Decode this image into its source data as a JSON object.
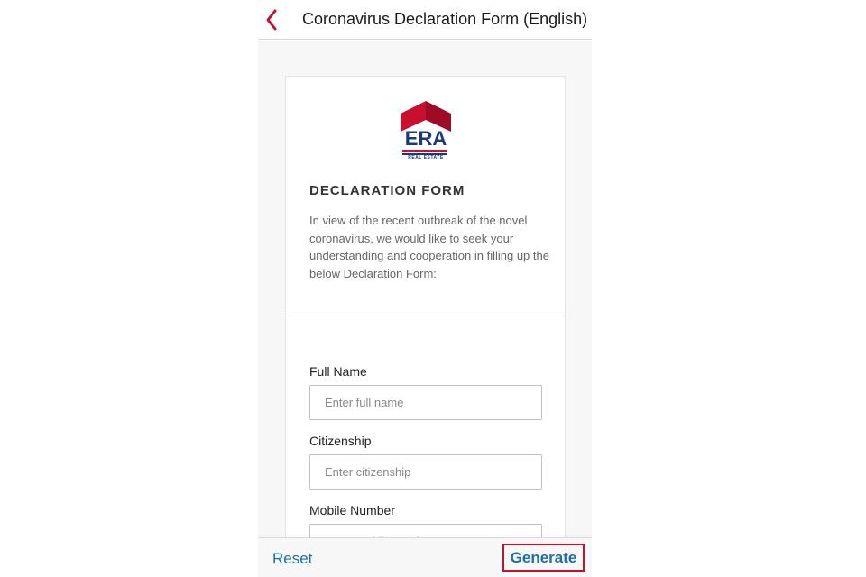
{
  "header": {
    "title": "Coronavirus Declaration Form (English)",
    "back_icon": "chevron-left-icon"
  },
  "colors": {
    "accent_red": "#c8102e",
    "link_blue": "#1c6fa8",
    "brand_blue": "#1b3a7a"
  },
  "logo": {
    "word": "ERA",
    "subtitle": "REAL ESTATE"
  },
  "form": {
    "heading": "DECLARATION FORM",
    "intro": "In view of the recent outbreak of the novel coronavirus, we would like to seek your understanding and cooperation in filling up the below Declaration Form:",
    "fields": [
      {
        "label": "Full Name",
        "placeholder": "Enter full name"
      },
      {
        "label": "Citizenship",
        "placeholder": "Enter citizenship"
      },
      {
        "label": "Mobile Number",
        "placeholder": "Enter mobile number"
      }
    ]
  },
  "footer": {
    "reset_label": "Reset",
    "generate_label": "Generate"
  }
}
